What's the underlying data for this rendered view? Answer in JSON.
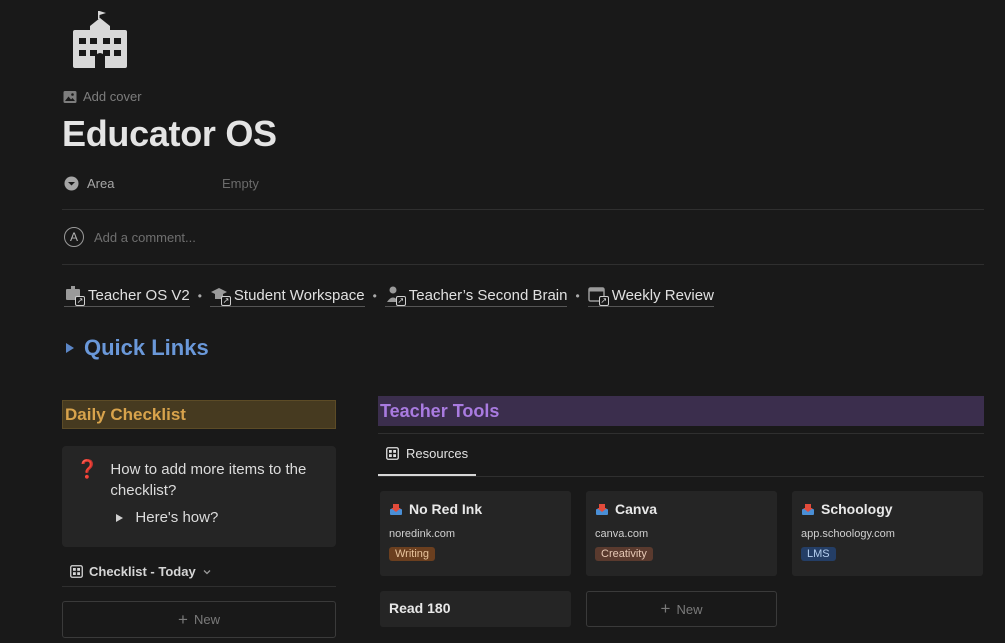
{
  "page": {
    "icon": "school-building-icon",
    "add_cover": "Add cover",
    "title": "Educator OS",
    "property": {
      "name": "Area",
      "value": "Empty"
    },
    "comment_placeholder": "Add a comment...",
    "avatar_initial": "A"
  },
  "links": [
    {
      "label": "Teacher OS V2",
      "icon": "teacher-board-icon"
    },
    {
      "label": "Student Workspace",
      "icon": "graduation-cap-icon"
    },
    {
      "label": "Teacher’s Second Brain",
      "icon": "teacher-icon"
    },
    {
      "label": "Weekly Review",
      "icon": "calendar-icon"
    }
  ],
  "quick_links": {
    "label": "Quick Links",
    "color": "#6a98d9"
  },
  "daily": {
    "header": "Daily Checklist",
    "callout_icon": "❓",
    "callout_text": "How to add more items to the checklist?",
    "toggle_label": "Here's how?",
    "view_label": "Checklist - Today",
    "new_label": "New"
  },
  "tools": {
    "header": "Teacher Tools",
    "tab_label": "Resources",
    "cards": [
      {
        "title": "No Red Ink",
        "url": "noredink.com",
        "tag": "Writing",
        "tag_bg": "#6b3f1f",
        "tag_fg": "#e7c39c"
      },
      {
        "title": "Canva",
        "url": "canva.com",
        "tag": "Creativity",
        "tag_bg": "#5a3a2e",
        "tag_fg": "#e6c8b5"
      },
      {
        "title": "Schoology",
        "url": "app.schoology.com",
        "tag": "LMS",
        "tag_bg": "#243e66",
        "tag_fg": "#b5cff0"
      },
      {
        "title": "Read 180"
      }
    ],
    "new_label": "New"
  }
}
